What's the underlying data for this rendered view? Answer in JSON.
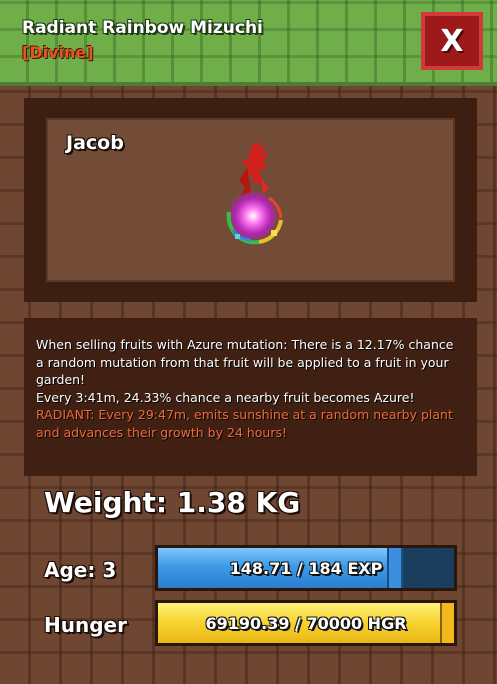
{
  "header": {
    "pet_name": "Radiant Rainbow Mizuchi",
    "rarity": "[Divine]",
    "close_label": "X"
  },
  "viewport": {
    "owner_name": "Jacob"
  },
  "description": {
    "line1": "When selling fruits with Azure mutation: There is a 12.17% chance a random mutation from that fruit will be applied to a fruit in your garden!",
    "line2": "Every 3:41m, 24.33% chance a nearby fruit becomes Azure!",
    "radiant": "RADIANT: Every 29:47m, emits sunshine at a random nearby plant and advances their growth by 24 hours!"
  },
  "stats": {
    "weight": "Weight: 1.38 KG",
    "age_label": "Age: 3",
    "hunger_label": "Hunger",
    "exp_text": "148.71 / 184 EXP",
    "exp_progress": 0.808,
    "hgr_text": "69190.39 / 70000 HGR",
    "hgr_progress": 0.988
  },
  "colors": {
    "header_green": "#6fae49",
    "close_red": "#9e1a1a",
    "rarity_orange": "#e8561f",
    "radiant_text": "#ef6a3a",
    "exp_blue": "#3f9be6",
    "hunger_yellow": "#f6d32e"
  }
}
